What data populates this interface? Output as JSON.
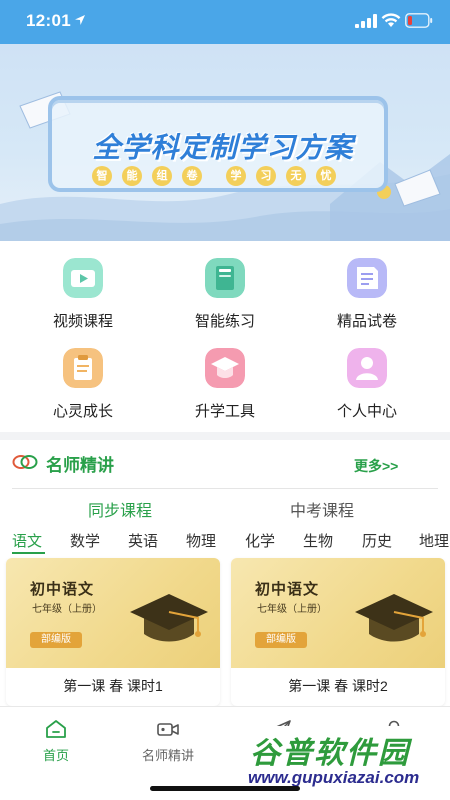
{
  "status_bar": {
    "time": "12:01"
  },
  "banner": {
    "title": "全学科定制学习方案",
    "tags": [
      "智",
      "能",
      "组",
      "卷",
      "学",
      "习",
      "无",
      "忧"
    ]
  },
  "features": [
    {
      "label": "视频课程",
      "icon": "video-course-icon",
      "color": "#8be0c9"
    },
    {
      "label": "智能练习",
      "icon": "smart-practice-icon",
      "color": "#5cc6a8"
    },
    {
      "label": "精品试卷",
      "icon": "premium-paper-icon",
      "color": "#a7a9f5"
    },
    {
      "label": "心灵成长",
      "icon": "mind-growth-icon",
      "color": "#f3b26a"
    },
    {
      "label": "升学工具",
      "icon": "education-tools-icon",
      "color": "#f28aa0"
    },
    {
      "label": "个人中心",
      "icon": "personal-center-icon",
      "color": "#e9a6e6"
    }
  ],
  "famous_teacher": {
    "title": "名师精讲",
    "more": "更多>>",
    "tabs": [
      "同步课程",
      "中考课程"
    ],
    "subjects": [
      "语文",
      "数学",
      "英语",
      "物理",
      "化学",
      "生物",
      "历史",
      "地理"
    ],
    "active_subject": "语文",
    "courses": [
      {
        "cover_title": "初中语文",
        "grade": "七年级（上册）",
        "badge": "部编版",
        "caption": "第一课 春 课时1"
      },
      {
        "cover_title": "初中语文",
        "grade": "七年级（上册）",
        "badge": "部编版",
        "caption": "第一课 春 课时2"
      }
    ]
  },
  "bottom_nav": [
    {
      "label": "首页",
      "icon": "home-icon",
      "active": true
    },
    {
      "label": "名师精讲",
      "icon": "video-camera-icon",
      "active": false
    },
    {
      "label": "",
      "icon": "paper-plane-icon",
      "active": false
    },
    {
      "label": "",
      "icon": "person-icon",
      "active": false
    }
  ],
  "watermark": {
    "brand": "谷普软件园",
    "url": "www.gupuxiazai.com"
  },
  "colors": {
    "accent": "#29a04a",
    "status_bar": "#4aa6e8",
    "card_gold": "#f1d98c"
  }
}
